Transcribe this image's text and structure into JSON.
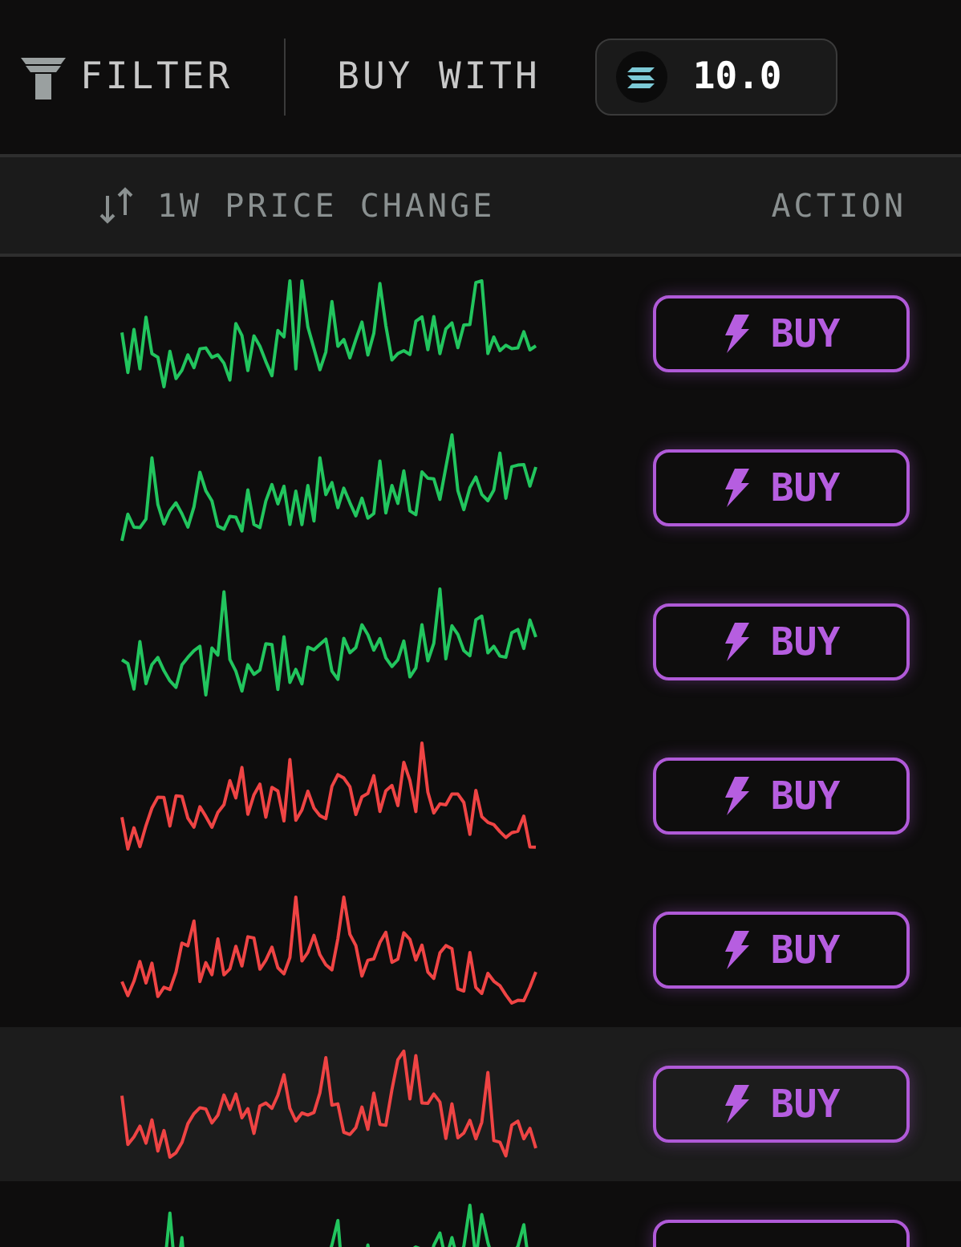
{
  "toolbar": {
    "filter_label": "FILTER",
    "buy_with_label": "BUY WITH",
    "amount": "10.0"
  },
  "table": {
    "columns": [
      "1W PRICE CHANGE",
      "ACTION"
    ],
    "rows": [
      {
        "color": "#22c55e",
        "selected": false,
        "action": "BUY"
      },
      {
        "color": "#22c55e",
        "selected": false,
        "action": "BUY"
      },
      {
        "color": "#22c55e",
        "selected": false,
        "action": "BUY"
      },
      {
        "color": "#ef4444",
        "selected": false,
        "action": "BUY"
      },
      {
        "color": "#ef4444",
        "selected": false,
        "action": "BUY"
      },
      {
        "color": "#ef4444",
        "selected": true,
        "action": "BUY"
      },
      {
        "color": "#22c55e",
        "selected": false
      }
    ]
  }
}
